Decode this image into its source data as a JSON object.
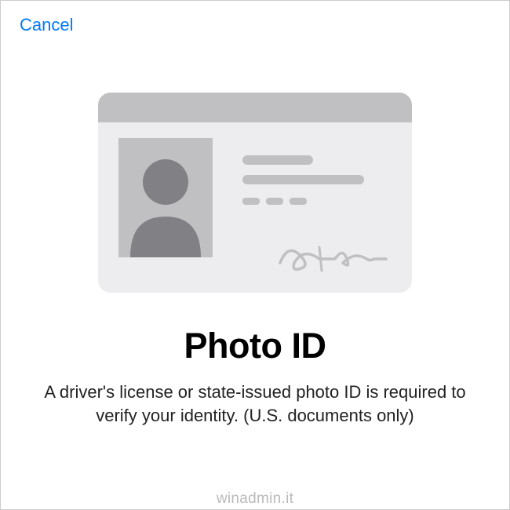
{
  "header": {
    "cancel_label": "Cancel"
  },
  "main": {
    "title": "Photo ID",
    "description": "A driver's license or state-issued photo ID is required to verify your identity. (U.S. documents only)"
  },
  "watermark": "winadmin.it",
  "colors": {
    "accent": "#007aff",
    "card_bg": "#ededef",
    "card_strip": "#c0c0c3",
    "silhouette": "#808085"
  }
}
